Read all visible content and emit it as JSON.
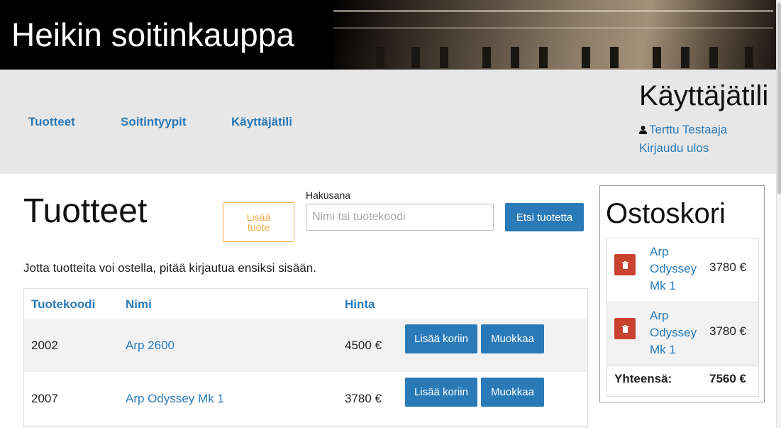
{
  "header": {
    "title": "Heikin soitinkauppa"
  },
  "nav": {
    "links": [
      "Tuotteet",
      "Soitintyypit",
      "Käyttäjätili"
    ],
    "account_title": "Käyttäjätili",
    "user_name": "Terttu Testaaja",
    "logout": "Kirjaudu ulos"
  },
  "main": {
    "title": "Tuotteet",
    "add_product_line1": "Lisää",
    "add_product_line2": "tuote",
    "search_label": "Hakusana",
    "search_placeholder": "Nimi tai tuotekoodi",
    "search_button": "Etsi tuotetta",
    "notice": "Jotta tuotteita voi ostella, pitää kirjautua ensiksi sisään."
  },
  "table": {
    "headers": [
      "Tuotekoodi",
      "Nimi",
      "Hinta"
    ],
    "rows": [
      {
        "code": "2002",
        "name": "Arp 2600",
        "price": "4500 €",
        "add": "Lisää koriin",
        "edit": "Muokkaa"
      },
      {
        "code": "2007",
        "name": "Arp Odyssey Mk 1",
        "price": "3780 €",
        "add": "Lisää koriin",
        "edit": "Muokkaa"
      }
    ]
  },
  "cart": {
    "title": "Ostoskori",
    "items": [
      {
        "name": "Arp Odyssey Mk 1",
        "price": "3780 €"
      },
      {
        "name": "Arp Odyssey Mk 1",
        "price": "3780 €"
      }
    ],
    "total_label": "Yhteensä:",
    "total_value": "7560 €"
  },
  "colors": {
    "link": "#2a7ab8",
    "warning": "#f0ad4e",
    "danger": "#c9422f",
    "navbar": "#e7e7e7"
  }
}
